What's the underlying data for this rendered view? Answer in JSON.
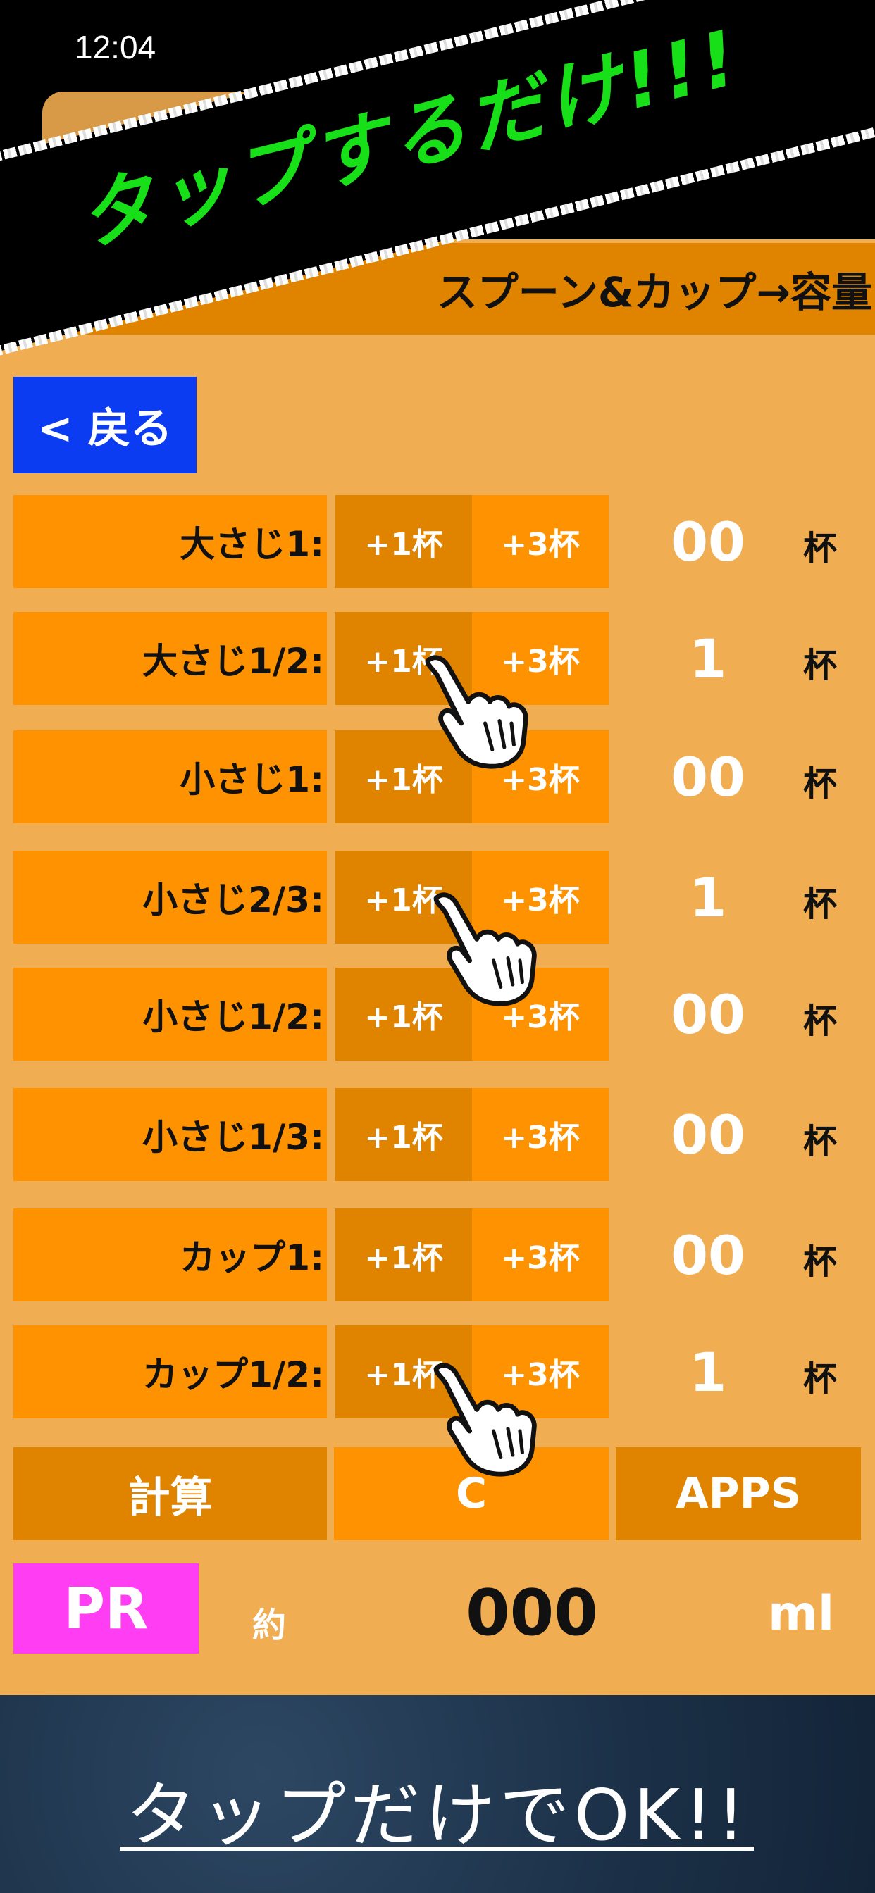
{
  "status_bar": {
    "time": "12:04"
  },
  "promo_banner": "タップするだけ!!!",
  "title": "スプーン&カップ→容量",
  "back_button": "< 戻る",
  "buttons": {
    "plus1": "+1杯",
    "plus3": "+3杯"
  },
  "unit": "杯",
  "rows": [
    {
      "label": "大さじ1:",
      "count": "00"
    },
    {
      "label": "大さじ1/2:",
      "count": "1"
    },
    {
      "label": "小さじ1:",
      "count": "00"
    },
    {
      "label": "小さじ2/3:",
      "count": "1"
    },
    {
      "label": "小さじ1/2:",
      "count": "00"
    },
    {
      "label": "小さじ1/3:",
      "count": "00"
    },
    {
      "label": "カップ1:",
      "count": "00"
    },
    {
      "label": "カップ1/2:",
      "count": "1"
    }
  ],
  "actions": {
    "calc": "計算",
    "clear": "C",
    "apps": "APPS"
  },
  "result": {
    "pr": "PR",
    "approx": "約",
    "value": "000",
    "unit": "ml"
  },
  "footer": "タップだけでOK!!",
  "colors": {
    "panel": "#f0ad52",
    "row_orange": "#ff9200",
    "dark_orange": "#e08400",
    "back_blue": "#0b3cf2",
    "pr_pink": "#ff3df3",
    "promo_green": "#18e018"
  }
}
